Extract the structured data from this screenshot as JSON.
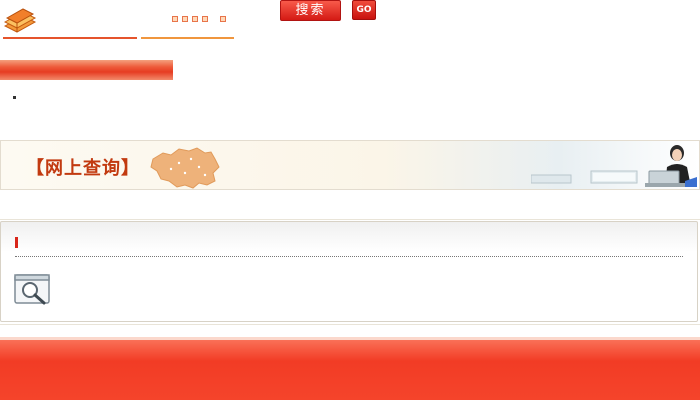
{
  "header": {
    "search_label": "搜索",
    "go_label": "GO"
  },
  "banner": {
    "title": "【网上查询】"
  },
  "colors": {
    "brand_red": "#e63c22",
    "accent_orange": "#f0963e",
    "banner_title": "#c23a10"
  }
}
